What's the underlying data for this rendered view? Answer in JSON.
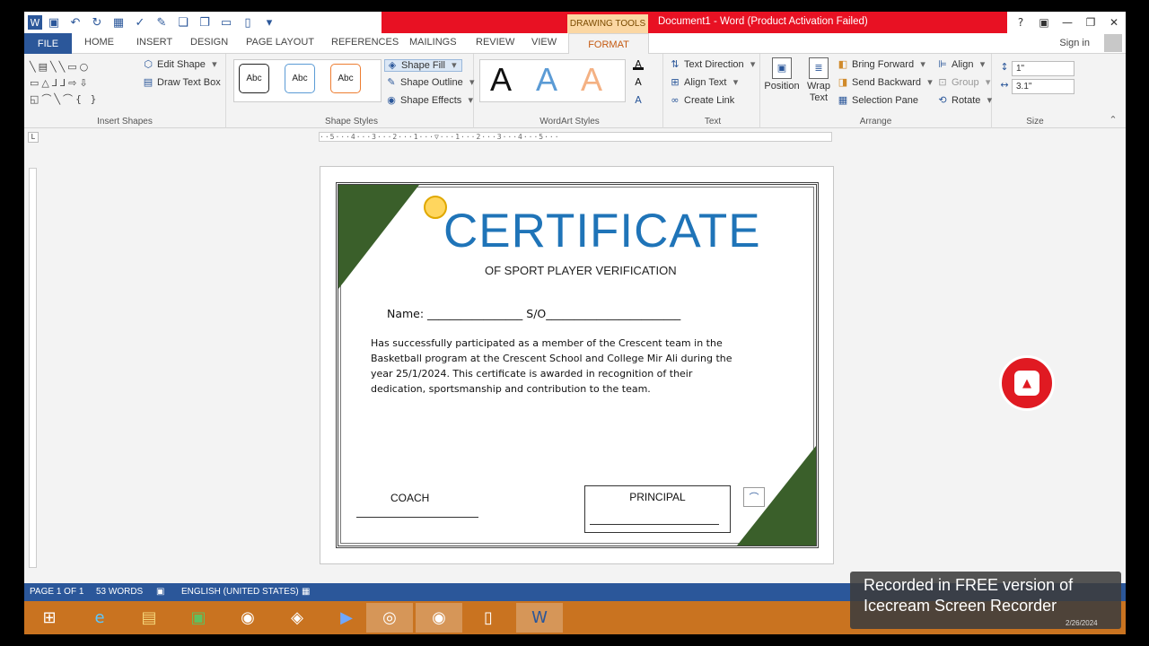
{
  "window": {
    "drawing_tools_label": "DRAWING TOOLS",
    "title": "Document1 -  Word (Product Activation Failed)",
    "controls": [
      "?",
      "▣",
      "—",
      "❐",
      "✕"
    ]
  },
  "tabs": {
    "file": "FILE",
    "items": [
      "HOME",
      "INSERT",
      "DESIGN",
      "PAGE LAYOUT",
      "REFERENCES",
      "MAILINGS",
      "REVIEW",
      "VIEW"
    ],
    "format": "FORMAT",
    "sign_in": "Sign in"
  },
  "ribbon": {
    "insert_shapes": {
      "label": "Insert Shapes",
      "edit_shape": "Edit Shape",
      "draw_text_box": "Draw Text Box"
    },
    "shape_styles": {
      "label": "Shape Styles",
      "samples": [
        "Abc",
        "Abc",
        "Abc"
      ],
      "sample_colors": [
        "#222222",
        "#5b9bd5",
        "#ed7d31"
      ],
      "shape_fill": "Shape Fill",
      "shape_outline": "Shape Outline",
      "shape_effects": "Shape Effects"
    },
    "wordart_styles": {
      "label": "WordArt Styles",
      "samples": [
        "A",
        "A",
        "A"
      ],
      "sample_colors": [
        "#111111",
        "#5b9bd5",
        "#f4b183"
      ]
    },
    "text": {
      "label": "Text",
      "text_direction": "Text Direction",
      "align_text": "Align Text",
      "create_link": "Create Link"
    },
    "arrange": {
      "label": "Arrange",
      "position": "Position",
      "wrap_text": "Wrap Text",
      "bring_forward": "Bring Forward",
      "send_backward": "Send Backward",
      "selection_pane": "Selection Pane",
      "align": "Align",
      "group": "Group",
      "rotate": "Rotate"
    },
    "size": {
      "label": "Size",
      "height": "1\"",
      "width": "3.1\""
    }
  },
  "document": {
    "title": "CERTIFICATE",
    "subtitle": "OF SPORT PLAYER VERIFICATION",
    "name_line": "Name: _________________ S/O________________________",
    "body": "Has successfully participated as a member of the Crescent team in the Basketball program at the Crescent School and College Mir Ali during the year 25/1/2024. This certificate is awarded in recognition of their dedication, sportsmanship and contribution to the team.",
    "coach": "COACH",
    "principal": "PRINCIPAL",
    "accent_color": "#3a5f2a",
    "title_color": "#1f74b8"
  },
  "status": {
    "page": "PAGE 1 OF 1",
    "words": "53 WORDS",
    "language": "ENGLISH (UNITED STATES)"
  },
  "watermark": {
    "line1": "Recorded in FREE version of",
    "line2": "Icecream  Screen  Recorder"
  },
  "taskbar": {
    "date": "2/26/2024"
  }
}
